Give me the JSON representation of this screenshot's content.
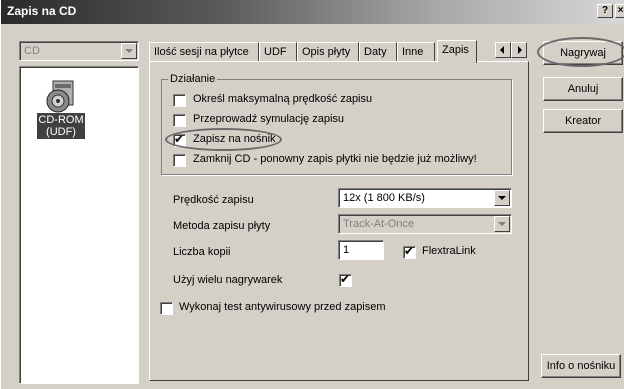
{
  "window": {
    "title": "Zapis na CD",
    "help_glyph": "?",
    "close_glyph": "×"
  },
  "drive_select": {
    "value": "CD"
  },
  "device": {
    "icon": "cd-drive-icon",
    "label_line1": "CD-ROM",
    "label_line2": "(UDF)"
  },
  "tabs": [
    {
      "label": "Ilość sesji na płytce"
    },
    {
      "label": "UDF"
    },
    {
      "label": "Opis płyty"
    },
    {
      "label": "Daty"
    },
    {
      "label": "Inne"
    },
    {
      "label": "Zapis"
    }
  ],
  "active_tab": "Zapis",
  "group": {
    "title": "Działanie",
    "options": [
      {
        "label": "Określ maksymalną prędkość zapisu",
        "checked": false
      },
      {
        "label": "Przeprowadź symulację zapisu",
        "checked": false
      },
      {
        "label": "Zapisz na nośnik",
        "checked": true
      },
      {
        "label": "Zamknij CD - ponowny zapis płytki nie będzie już możliwy!",
        "checked": false
      }
    ]
  },
  "settings": {
    "speed_label": "Prędkość zapisu",
    "speed_value": "12x (1 800 KB/s)",
    "method_label": "Metoda zapisu płyty",
    "method_value": "Track-At-Once",
    "copies_label": "Liczba kopii",
    "copies_value": "1",
    "flextra_label": "FlextraLink",
    "flextra_checked": true,
    "multi_label": "Użyj wielu nagrywarek",
    "multi_checked": true,
    "antivirus_label": "Wykonaj test antywirusowy przed zapisem",
    "antivirus_checked": false
  },
  "buttons": {
    "burn": "Nagrywaj",
    "cancel": "Anuluj",
    "wizard": "Kreator",
    "media_info": "Info o nośniku"
  },
  "colors": {
    "highlight_oval": "#6a6a6a"
  }
}
